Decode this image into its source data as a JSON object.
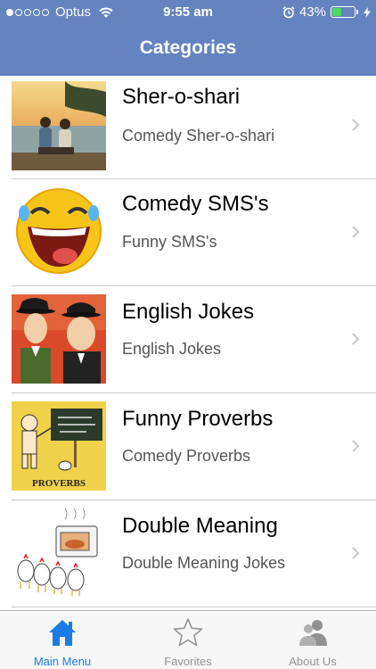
{
  "status_bar": {
    "carrier": "Optus",
    "signal_filled": 1,
    "signal_total": 5,
    "time": "9:55 am",
    "battery_text": "43%",
    "battery_level": 0.43
  },
  "nav": {
    "title": "Categories"
  },
  "categories": [
    {
      "title": "Sher-o-shari",
      "subtitle": "Comedy Sher-o-shari",
      "thumb": "couple-sunset-photo"
    },
    {
      "title": "Comedy SMS's",
      "subtitle": "Funny SMS's",
      "thumb": "laughing-smiley"
    },
    {
      "title": "English Jokes",
      "subtitle": "English Jokes",
      "thumb": "comedy-duo-illustration"
    },
    {
      "title": "Funny Proverbs",
      "subtitle": "Comedy Proverbs",
      "thumb": "proverbs-cartoon",
      "thumb_text": "PROVERBS"
    },
    {
      "title": "Double Meaning",
      "subtitle": "Double Meaning Jokes",
      "thumb": "chickens-oven-cartoon"
    }
  ],
  "tabbar": {
    "items": [
      {
        "label": "Main Menu",
        "icon": "home-icon",
        "active": true
      },
      {
        "label": "Favorites",
        "icon": "star-icon",
        "active": false
      },
      {
        "label": "About Us",
        "icon": "people-icon",
        "active": false
      }
    ]
  },
  "colors": {
    "nav_bar": "#6483bf",
    "tab_active": "#1a7de5",
    "tab_inactive": "#929292",
    "battery_green": "#4cd964"
  }
}
